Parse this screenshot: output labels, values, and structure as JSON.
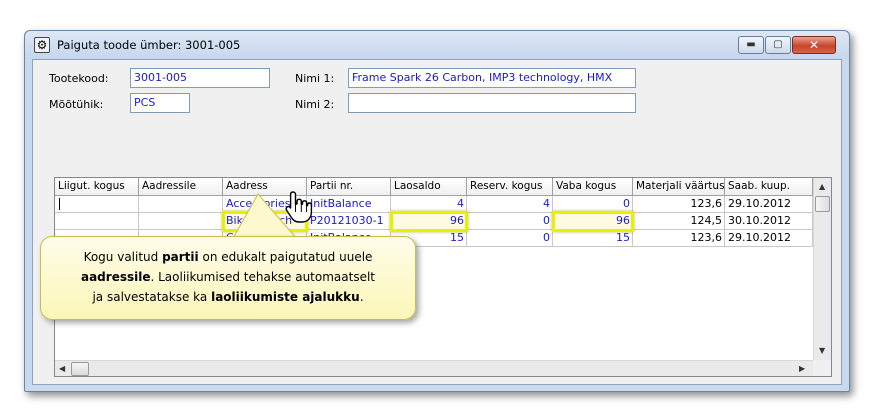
{
  "window": {
    "title": "Paiguta toode ümber: 3001-005",
    "minimize_glyph": "▬",
    "maximize_glyph": "▢",
    "close_glyph": "✕"
  },
  "form": {
    "tootekood_label": "Tootekood:",
    "tootekood_value": "3001-005",
    "mootuhik_label": "Mõõtühik:",
    "mootuhik_value": "PCS",
    "nimi1_label": "Nimi 1:",
    "nimi1_value": "Frame Spark 26 Carbon, IMP3 technology, HMX",
    "nimi2_label": "Nimi 2:",
    "nimi2_value": ""
  },
  "grid": {
    "columns": [
      "Liigut. kogus",
      "Aadressile",
      "Aadress",
      "Partii nr.",
      "Laosaldo",
      "Reserv. kogus",
      "Vaba kogus",
      "Materjali väärtus",
      "Saab. kuup."
    ],
    "rows": [
      [
        "",
        "",
        "Accessories",
        "InitBalance",
        "4",
        "4",
        "0",
        "123,6",
        "29.10.2012"
      ],
      [
        "",
        "",
        "Bikes26inch",
        "P20121030-1",
        "96",
        "0",
        "96",
        "124,5",
        "30.10.2012"
      ],
      [
        "",
        "",
        "Components",
        "InitBalance",
        "15",
        "0",
        "15",
        "123,6",
        "29.10.2012"
      ]
    ]
  },
  "callout": {
    "t1": "Kogu valitud ",
    "t2": "partii",
    "t3": " on edukalt paigutatud uuele",
    "t4": "aadressile",
    "t5": ". Laoliikumised tehakse automaatselt",
    "t6": "ja salvestatakse ka ",
    "t7": "laoliikumiste ajalukku",
    "t8": "."
  },
  "icons": {
    "app": "app-icon",
    "cursor": "hand-pointer-icon"
  },
  "colors": {
    "value_text": "#1a1ad0",
    "highlight": "#e6f000",
    "callout_bg": "#fbf6b8"
  }
}
